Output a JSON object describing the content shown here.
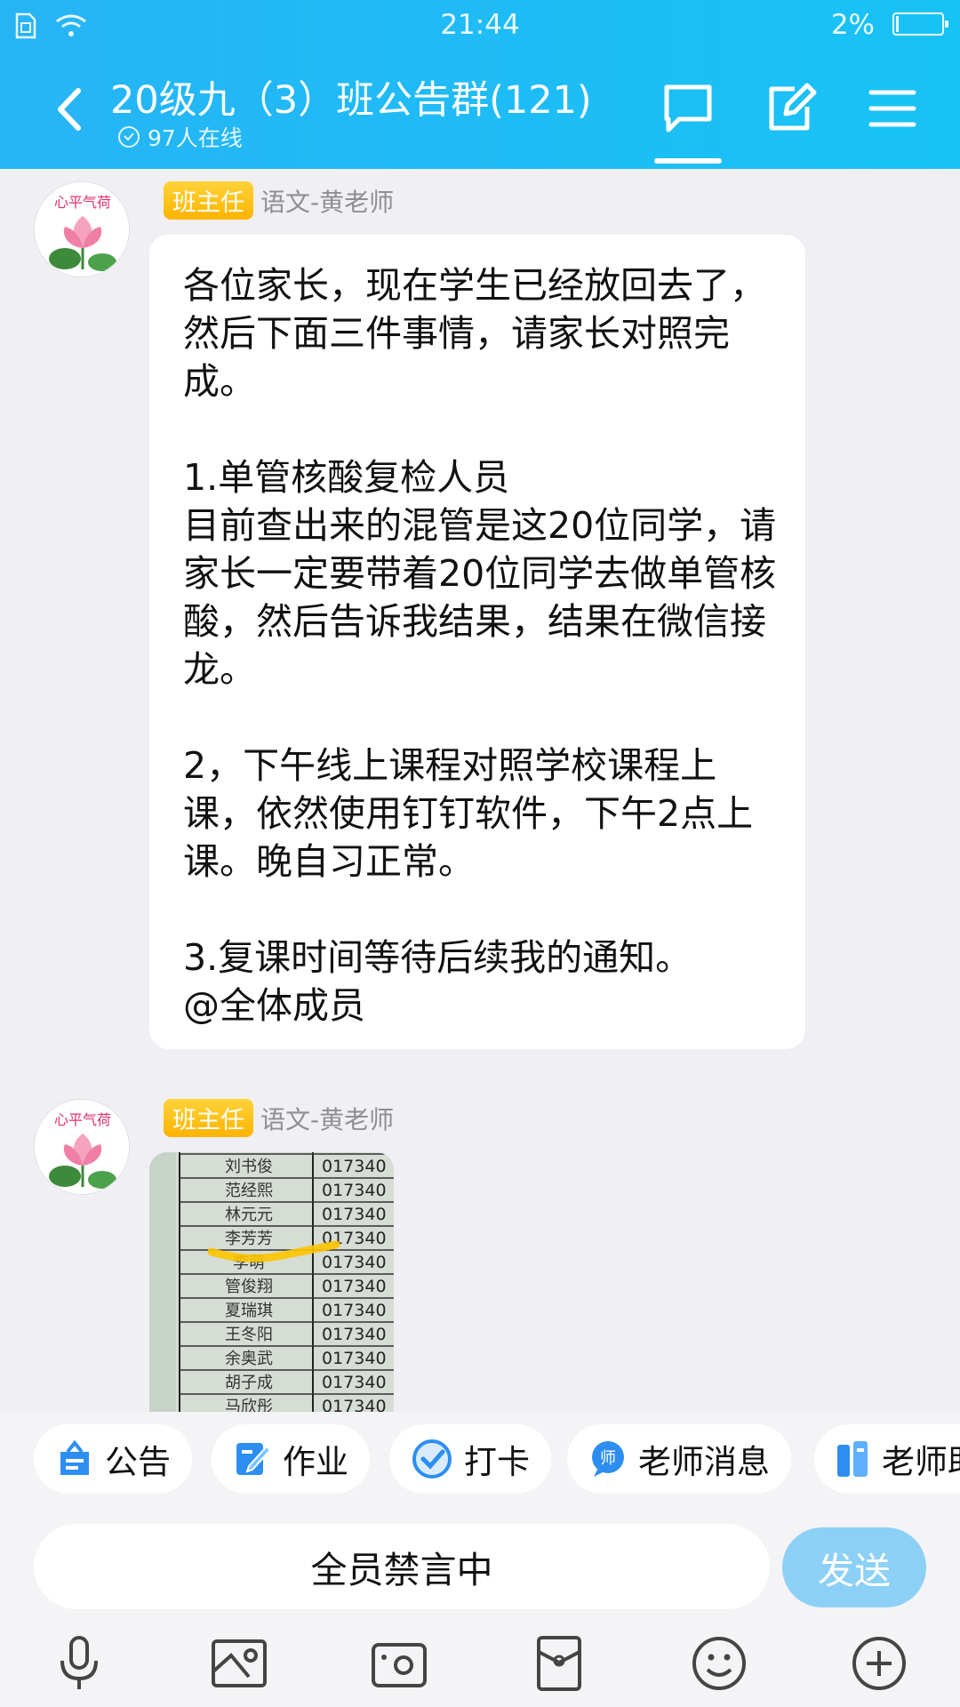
{
  "status": {
    "time": "21:44",
    "battery": "2%"
  },
  "header": {
    "title": "20级九（3）班公告群(121)",
    "online": "97人在线",
    "icons": [
      "chat-icon",
      "edit-icon",
      "menu-icon"
    ]
  },
  "messages": [
    {
      "role": "班主任",
      "sender": "语文-黄老师",
      "avatar_text": "心平气荷",
      "text": "各位家长，现在学生已经放回去了，然后下面三件事情，请家长对照完成。\n\n1.单管核酸复检人员\n目前查出来的混管是这20位同学，请家长一定要带着20位同学去做单管核酸，然后告诉我结果，结果在微信接龙。\n\n2，下午线上课程对照学校课程上课，依然使用钉钉软件，下午2点上课。晚自习正常。\n\n3.复课时间等待后续我的通知。\n@全体成员"
    },
    {
      "role": "班主任",
      "sender": "语文-黄老师",
      "avatar_text": "心平气荷",
      "image_rows": [
        {
          "name": "刘书俊",
          "id": "017340"
        },
        {
          "name": "范经熙",
          "id": "017340"
        },
        {
          "name": "林元元",
          "id": "017340"
        },
        {
          "name": "李芳芳",
          "id": "017340"
        },
        {
          "name": "李萌",
          "id": "017340"
        },
        {
          "name": "管俊翔",
          "id": "017340"
        },
        {
          "name": "夏瑞琪",
          "id": "017340"
        },
        {
          "name": "王冬阳",
          "id": "017340"
        },
        {
          "name": "余奥武",
          "id": "017340"
        },
        {
          "name": "胡子成",
          "id": "017340"
        },
        {
          "name": "马欣彤",
          "id": "017340"
        }
      ]
    }
  ],
  "quick_tools": [
    {
      "label": "公告",
      "icon": "announcement-icon"
    },
    {
      "label": "作业",
      "icon": "homework-icon"
    },
    {
      "label": "打卡",
      "icon": "checkin-icon"
    },
    {
      "label": "老师消息",
      "icon": "teacher-message-icon"
    },
    {
      "label": "老师助",
      "icon": "teacher-assistant-icon"
    }
  ],
  "input": {
    "placeholder": "全员禁言中",
    "send": "发送"
  },
  "toolbar": [
    "microphone-icon",
    "image-icon",
    "camera-icon",
    "mailbox-icon",
    "emoji-icon",
    "plus-icon"
  ],
  "colors": {
    "header": "#1fbcf5",
    "badge": "#ffc21a",
    "send": "#8cd0f6"
  }
}
